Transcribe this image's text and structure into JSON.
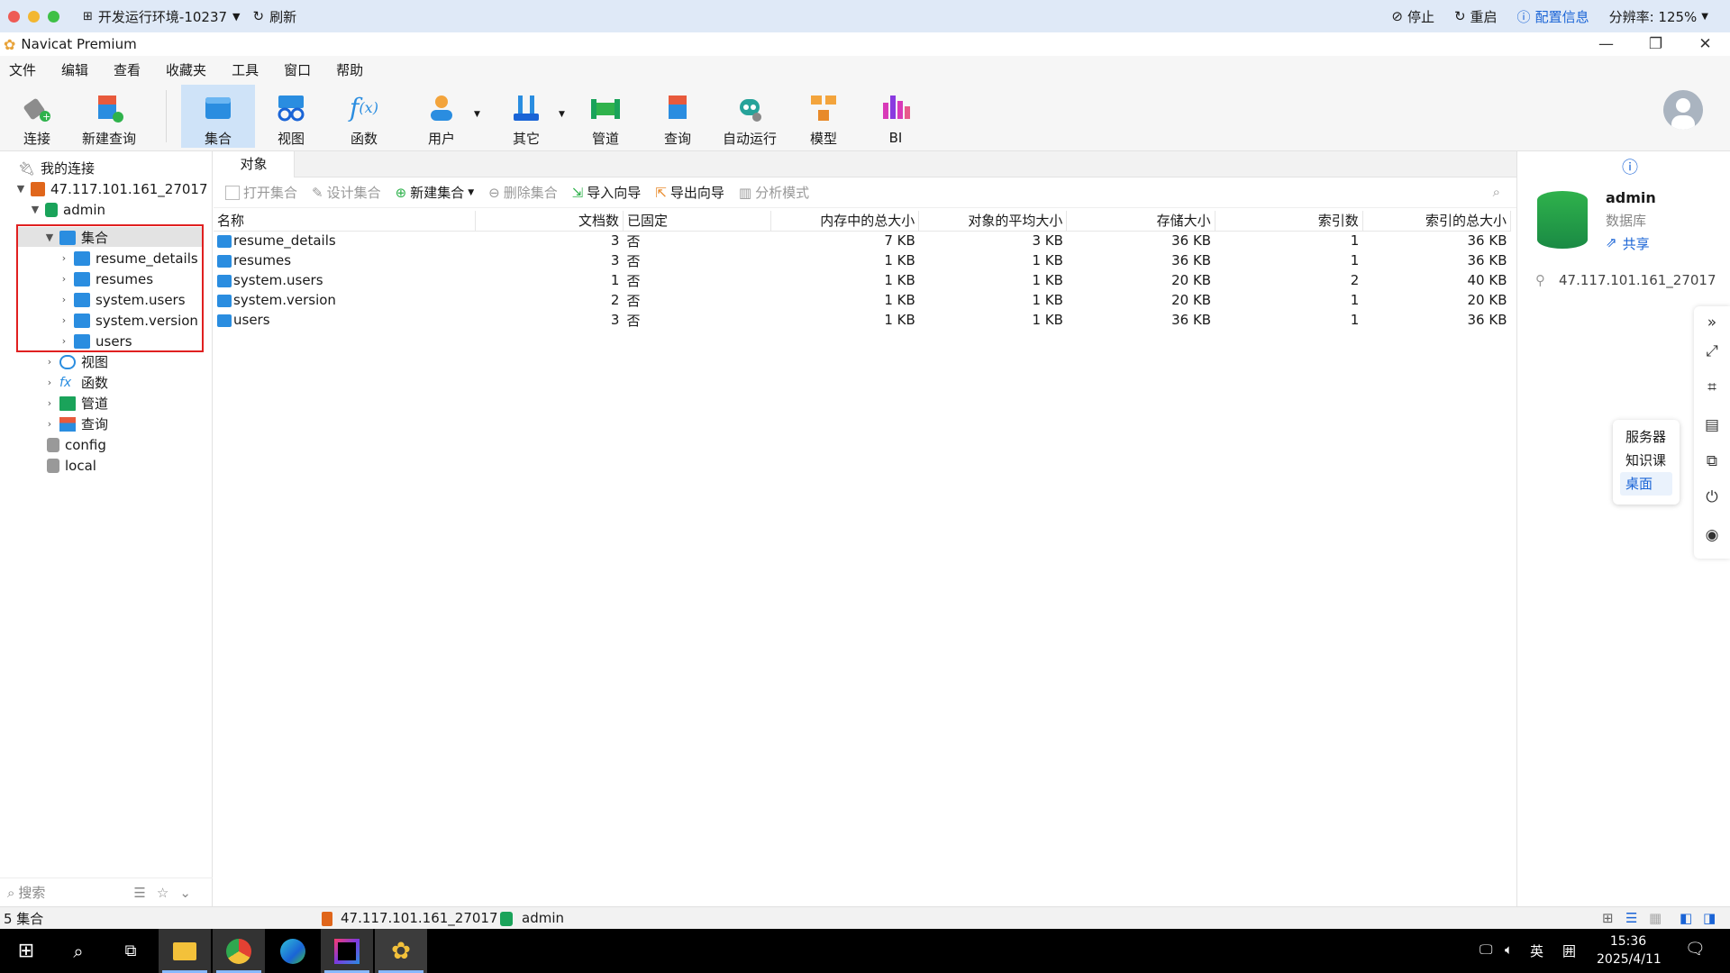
{
  "remote_bar": {
    "env_label": "开发运行环境-10237",
    "refresh_label": "刷新",
    "stop_label": "停止",
    "restart_label": "重启",
    "config_label": "配置信息",
    "resolution_label": "分辨率: 125%"
  },
  "window": {
    "app_title": "Navicat Premium"
  },
  "menu": {
    "items": [
      "文件",
      "编辑",
      "查看",
      "收藏夹",
      "工具",
      "窗口",
      "帮助"
    ]
  },
  "toolbar": {
    "buttons": [
      {
        "label": "连接",
        "icon": "plug-icon"
      },
      {
        "label": "新建查询",
        "icon": "new-query-icon"
      },
      {
        "label": "集合",
        "icon": "collection-icon"
      },
      {
        "label": "视图",
        "icon": "view-icon"
      },
      {
        "label": "函数",
        "icon": "function-icon"
      },
      {
        "label": "用户",
        "icon": "user-icon"
      },
      {
        "label": "其它",
        "icon": "tools-icon"
      },
      {
        "label": "管道",
        "icon": "pipeline-icon"
      },
      {
        "label": "查询",
        "icon": "query-icon"
      },
      {
        "label": "自动运行",
        "icon": "robot-icon"
      },
      {
        "label": "模型",
        "icon": "model-icon"
      },
      {
        "label": "BI",
        "icon": "bi-icon"
      }
    ]
  },
  "sidebar": {
    "my_connections": "我的连接",
    "connection": "47.117.101.161_27017",
    "database": "admin",
    "collections_node": "集合",
    "collections": [
      "resume_details",
      "resumes",
      "system.users",
      "system.version",
      "users"
    ],
    "other_nodes": [
      "视图",
      "函数",
      "管道",
      "查询"
    ],
    "other_dbs": [
      "config",
      "local"
    ],
    "search_placeholder": "搜索"
  },
  "main": {
    "tab": "对象",
    "object_toolbar": {
      "open": "打开集合",
      "design": "设计集合",
      "new": "新建集合",
      "delete": "删除集合",
      "import": "导入向导",
      "export": "导出向导",
      "analyze": "分析模式"
    },
    "columns": [
      "名称",
      "文档数",
      "已固定",
      "内存中的总大小",
      "对象的平均大小",
      "存储大小",
      "索引数",
      "索引的总大小"
    ],
    "rows": [
      [
        "resume_details",
        "3",
        "否",
        "7 KB",
        "3 KB",
        "36 KB",
        "1",
        "36 KB"
      ],
      [
        "resumes",
        "3",
        "否",
        "1 KB",
        "1 KB",
        "36 KB",
        "1",
        "36 KB"
      ],
      [
        "system.users",
        "1",
        "否",
        "1 KB",
        "1 KB",
        "20 KB",
        "2",
        "40 KB"
      ],
      [
        "system.version",
        "2",
        "否",
        "1 KB",
        "1 KB",
        "20 KB",
        "1",
        "20 KB"
      ],
      [
        "users",
        "3",
        "否",
        "1 KB",
        "1 KB",
        "36 KB",
        "1",
        "36 KB"
      ]
    ]
  },
  "right_panel": {
    "db_name": "admin",
    "db_type": "数据库",
    "share": "共享",
    "host": "47.117.101.161_27017"
  },
  "popup": {
    "items": [
      "服务器",
      "知识课",
      "桌面"
    ]
  },
  "status": {
    "count": "5 集合",
    "connection": "47.117.101.161_27017",
    "database": "admin"
  },
  "taskbar": {
    "time": "15:36",
    "date": "2025/4/11",
    "ime": "英",
    "ime2": "囲"
  },
  "colors": {
    "accent": "#1a64d6",
    "highlight_box": "#e02020",
    "db_green": "#1aa35a"
  }
}
